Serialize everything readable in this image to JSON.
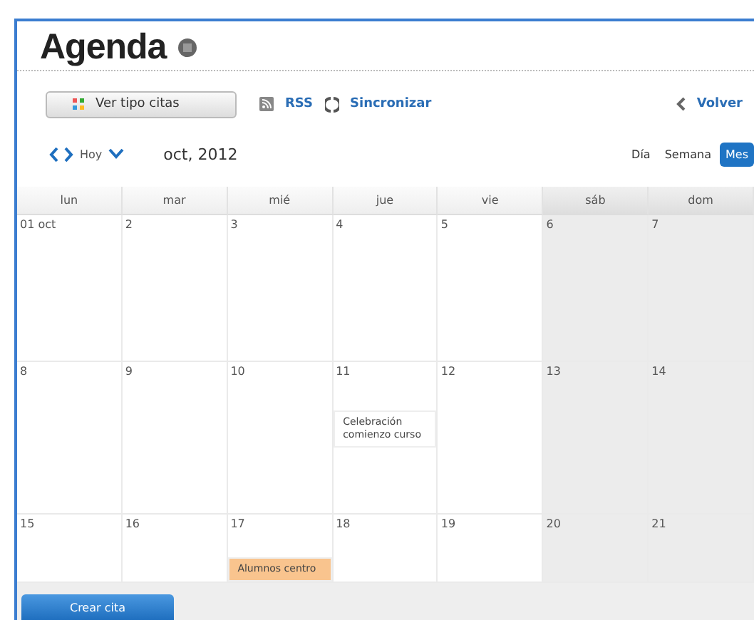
{
  "title": "Agenda",
  "toolbar": {
    "types_button": "Ver tipo citas",
    "rss": "RSS",
    "sync": "Sincronizar",
    "back": "Volver"
  },
  "nav": {
    "today": "Hoy",
    "period": "oct, 2012"
  },
  "views": [
    {
      "label": "Día",
      "selected": false
    },
    {
      "label": "Semana",
      "selected": false
    },
    {
      "label": "Mes",
      "selected": true
    }
  ],
  "weekdays": [
    {
      "label": "lun",
      "weekend": false
    },
    {
      "label": "mar",
      "weekend": false
    },
    {
      "label": "mié",
      "weekend": false
    },
    {
      "label": "jue",
      "weekend": false
    },
    {
      "label": "vie",
      "weekend": false
    },
    {
      "label": "sáb",
      "weekend": true
    },
    {
      "label": "dom",
      "weekend": true
    }
  ],
  "weeks": [
    {
      "days": [
        {
          "date": "01 oct"
        },
        {
          "date": "2"
        },
        {
          "date": "3"
        },
        {
          "date": "4"
        },
        {
          "date": "5"
        },
        {
          "date": "6"
        },
        {
          "date": "7"
        }
      ]
    },
    {
      "days": [
        {
          "date": "8"
        },
        {
          "date": "9"
        },
        {
          "date": "10"
        },
        {
          "date": "11",
          "events": [
            {
              "title": "Celebración comienzo curso",
              "color": "#ffffff"
            }
          ]
        },
        {
          "date": "12"
        },
        {
          "date": "13"
        },
        {
          "date": "14"
        }
      ]
    },
    {
      "days": [
        {
          "date": "15"
        },
        {
          "date": "16"
        },
        {
          "date": "17",
          "events": [
            {
              "title": "Alumnos centro",
              "color": "#f9c48e"
            }
          ]
        },
        {
          "date": "18"
        },
        {
          "date": "19"
        },
        {
          "date": "20"
        },
        {
          "date": "21"
        }
      ]
    }
  ],
  "create_button": "Crear cita"
}
